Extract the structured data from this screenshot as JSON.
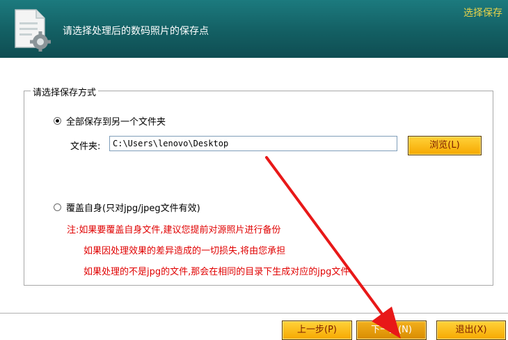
{
  "header": {
    "title": "请选择处理后的数码照片的保存点",
    "step_label": "选择保存"
  },
  "save_group": {
    "legend": "请选择保存方式",
    "option_folder": {
      "label": "全部保存到另一个文件夹",
      "selected": true
    },
    "folder_label": "文件夹:",
    "folder_path": "C:\\Users\\lenovo\\Desktop",
    "browse_button": "浏览(L)",
    "option_overwrite": {
      "label": "覆盖自身(只对jpg/jpeg文件有效)",
      "selected": false
    },
    "notes": [
      "注:如果要覆盖自身文件,建议您提前对源照片进行备份",
      "如果因处理效果的差异造成的一切损失,将由您承担",
      "如果处理的不是jpg的文件,那会在相同的目录下生成对应的jpg文件"
    ]
  },
  "footer": {
    "prev_button": "上一步(P)",
    "next_button": "下一步(N)",
    "exit_button": "退出(X)"
  },
  "colors": {
    "header_bg": "#135f63",
    "header_step": "#e9d34a",
    "button": "#f6a800",
    "note_red": "#e00000",
    "arrow_red": "#e81818"
  },
  "icons": [
    "document-gear-icon",
    "radio-icon",
    "red-arrow-annotation"
  ]
}
